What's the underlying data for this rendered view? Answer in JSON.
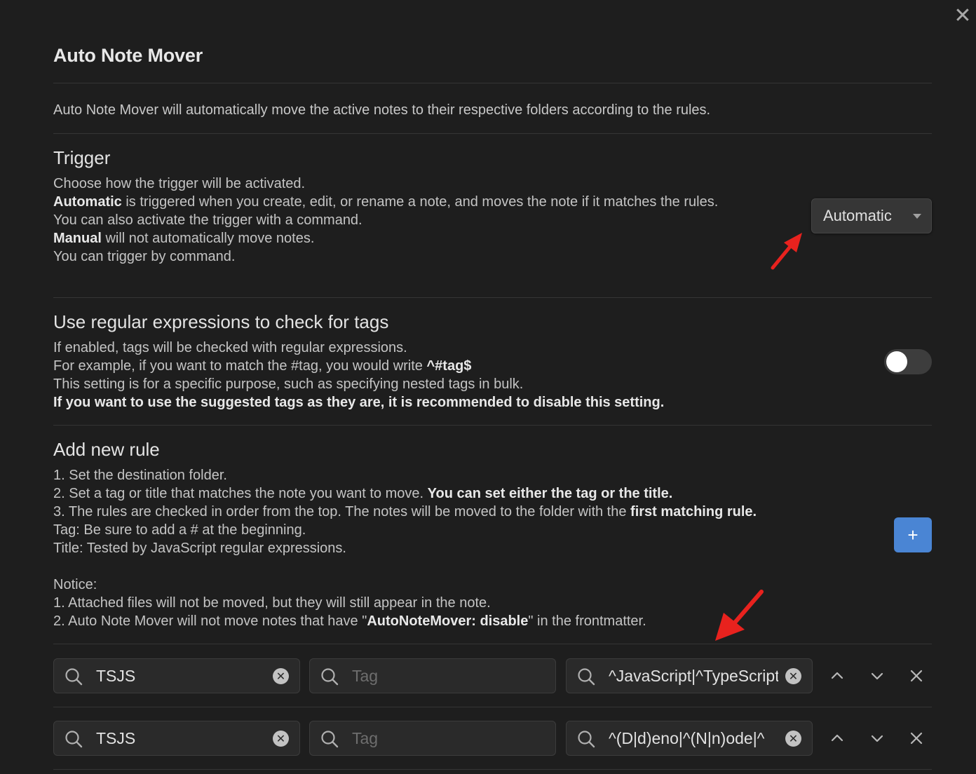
{
  "header": {
    "title": "Auto Note Mover"
  },
  "intro": "Auto Note Mover will automatically move the active notes to their respective folders according to the rules.",
  "trigger": {
    "name": "Trigger",
    "line1": "Choose how the trigger will be activated.",
    "line2_bold": "Automatic",
    "line2_rest": " is triggered when you create, edit, or rename a note, and moves the note if it matches the rules.",
    "line3": "You can also activate the trigger with a command.",
    "line4_bold": "Manual",
    "line4_rest": " will not automatically move notes.",
    "line5": "You can trigger by command.",
    "dropdown_value": "Automatic"
  },
  "regex": {
    "name": "Use regular expressions to check for tags",
    "line1": "If enabled, tags will be checked with regular expressions.",
    "line2_text": "For example, if you want to match the #tag, you would write ",
    "line2_bold": "^#tag$",
    "line3": "This setting is for a specific purpose, such as specifying nested tags in bulk.",
    "line4_bold": "If you want to use the suggested tags as they are, it is recommended to disable this setting.",
    "toggle_on": false
  },
  "add_rule": {
    "name": "Add new rule",
    "l1": "1. Set the destination folder.",
    "l2_text": "2. Set a tag or title that matches the note you want to move. ",
    "l2_bold": "You can set either the tag or the title.",
    "l3_text": "3. The rules are checked in order from the top. The notes will be moved to the folder with the ",
    "l3_bold": "first matching rule.",
    "l4": "Tag: Be sure to add a # at the beginning.",
    "l5": "Title: Tested by JavaScript regular expressions.",
    "l6": "Notice:",
    "l7": "1. Attached files will not be moved, but they will still appear in the note.",
    "l8_text": "2. Auto Note Mover will not move notes that have \"",
    "l8_bold": "AutoNoteMover: disable",
    "l8_rest": "\" in the frontmatter.",
    "button_label": "+"
  },
  "rules": [
    {
      "folder": "TSJS",
      "tag": "",
      "tag_placeholder": "Tag",
      "title": "^JavaScript|^TypeScript"
    },
    {
      "folder": "TSJS",
      "tag": "",
      "tag_placeholder": "Tag",
      "title": "^(D|d)eno|^(N|n)ode|^"
    }
  ],
  "colors": {
    "accent": "#4a85d4",
    "annotation_arrow": "#e8221e",
    "background": "#1e1e1e"
  }
}
